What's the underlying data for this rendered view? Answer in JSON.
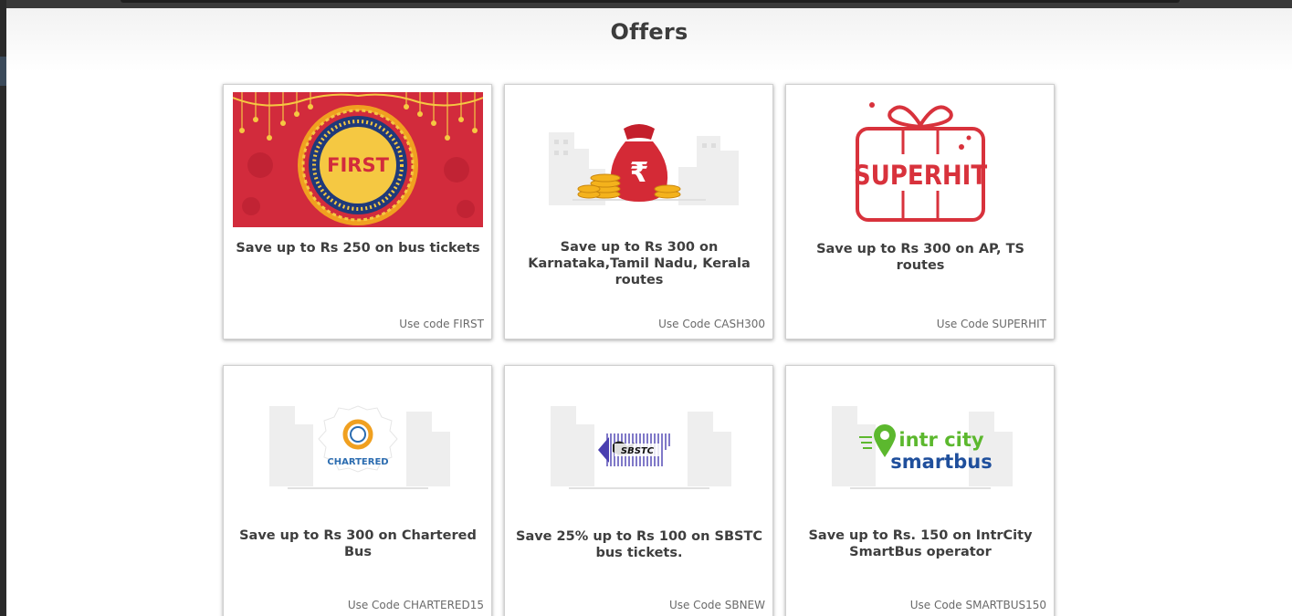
{
  "page": {
    "title": "Offers"
  },
  "offers": [
    {
      "badge": "FIRST",
      "description": "Save up to Rs 250 on bus tickets",
      "code_text": "Use code FIRST",
      "icon": "diwali-first-banner-icon"
    },
    {
      "badge": "₹",
      "description": "Save up to Rs 300 on Karnataka,Tamil Nadu, Kerala routes",
      "code_text": "Use Code CASH300",
      "icon": "rupee-money-bag-icon"
    },
    {
      "badge": "SUPERHIT",
      "description": "Save up to Rs 300 on AP, TS routes",
      "code_text": "Use Code SUPERHIT",
      "icon": "gift-box-icon"
    },
    {
      "badge": "CHARTERED",
      "description": "Save up to Rs 300 on Chartered Bus",
      "code_text": "Use Code CHARTERED15",
      "icon": "chartered-logo-icon"
    },
    {
      "badge": "SBSTC",
      "description": "Save 25% up to Rs 100 on SBSTC bus tickets.",
      "code_text": "Use Code SBNEW",
      "icon": "sbstc-logo-icon"
    },
    {
      "badge_line1": "intr city",
      "badge_line2": "smartbus",
      "description": "Save up to Rs. 150 on IntrCity SmartBus operator",
      "code_text": "Use Code SMARTBUS150",
      "icon": "intrcity-smartbus-logo-icon"
    }
  ],
  "colors": {
    "title": "#3c3c3c",
    "festive_red": "#d22b3c",
    "gold": "#f5c842",
    "superhit_red": "#d8323c",
    "intrcity_green": "#5cb82e",
    "intrcity_blue": "#1f4f9c"
  }
}
